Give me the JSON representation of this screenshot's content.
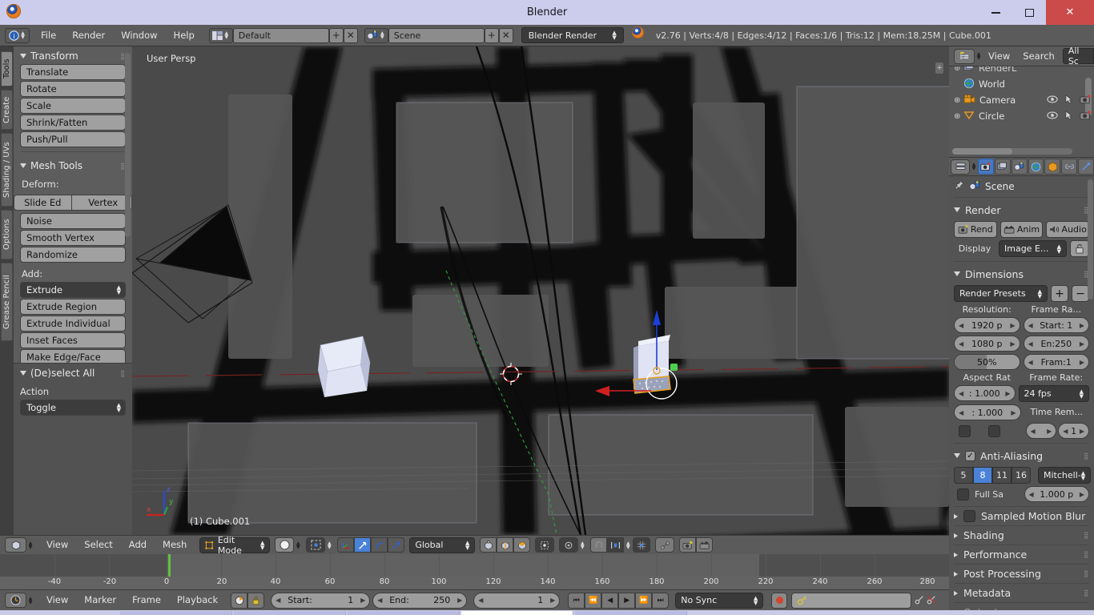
{
  "window": {
    "title": "Blender",
    "app_icon": "blender-logo-icon",
    "minimize": "minimize-icon",
    "maximize": "maximize-icon",
    "close": "close-icon"
  },
  "topbar": {
    "editor_icon": "info-editor-icon",
    "menus": [
      "File",
      "Render",
      "Window",
      "Help"
    ],
    "screen_layout": {
      "icon": "screen-layout-icon",
      "value": "Default",
      "add": "+",
      "remove": "x"
    },
    "scene": {
      "icon": "scene-icon",
      "value": "Scene",
      "add": "+",
      "remove": "x"
    },
    "render_engine": "Blender Render",
    "stats_icon": "blender-logo-icon",
    "stats": "v2.76 | Verts:4/8 | Edges:4/12 | Faces:1/6 | Tris:12 | Mem:18.25M | Cube.001"
  },
  "left_tabs": [
    {
      "label": "Tools",
      "active": true
    },
    {
      "label": "Create",
      "active": false
    },
    {
      "label": "Shading / UVs",
      "active": false
    },
    {
      "label": "Options",
      "active": false
    },
    {
      "label": "Grease Pencil",
      "active": false
    }
  ],
  "tool_shelf": {
    "transform": {
      "title": "Transform",
      "buttons": [
        "Translate",
        "Rotate",
        "Scale",
        "Shrink/Fatten",
        "Push/Pull"
      ]
    },
    "mesh_tools": {
      "title": "Mesh Tools",
      "deform_label": "Deform:",
      "deform_split": [
        "Slide Ed",
        "Vertex"
      ],
      "deform_buttons": [
        "Noise",
        "Smooth Vertex",
        "Randomize"
      ],
      "add_label": "Add:",
      "add_dropdown": "Extrude",
      "add_buttons": [
        "Extrude Region",
        "Extrude Individual",
        "Inset Faces",
        "Make Edge/Face"
      ]
    }
  },
  "operator_panel": {
    "title": "(De)select All",
    "action_label": "Action",
    "action_value": "Toggle"
  },
  "viewport": {
    "view_label": "User Persp",
    "object_label": "(1) Cube.001",
    "axis_gizmo": {
      "x": "x",
      "y": "y",
      "z": "z"
    },
    "colors": {
      "background": "#4a4a4a",
      "wall_dark": "#050505",
      "floor": "#555555",
      "cube_light": "#d8dced",
      "gizmo_z": "#1b3fd8",
      "gizmo_x": "#d82222",
      "gizmo_y": "#3cc23c",
      "cursor_red": "#c33",
      "selected_outline": "#e8a021"
    }
  },
  "viewport_header": {
    "editor_icon": "3d-view-icon",
    "menus": [
      "View",
      "Select",
      "Add",
      "Mesh"
    ],
    "mode": {
      "icon": "edit-mode-icon",
      "value": "Edit Mode"
    },
    "shading": "solid-shading-icon",
    "pivot": "pivot-median-icon",
    "snap_modes": [
      "manipulator-icon",
      "translate-manip-icon",
      "rotate-manip-icon",
      "scale-manip-icon"
    ],
    "orientation": "Global",
    "mesh_select_modes": [
      "vertex-select-icon",
      "edge-select-icon",
      "face-select-icon"
    ],
    "limit_selection": "limit-selection-icon",
    "proportional": "proportional-edit-icon",
    "proportional_falloff": "falloff-smooth-icon",
    "snap_magnet": "magnet-icon",
    "snap_target": "snap-target-icon",
    "snap_element": "snap-element-icon",
    "auto_merge": "automerge-icon",
    "render_opengl": "render-opengl-icon",
    "render_opengl_anim": "render-opengl-anim-icon"
  },
  "timeline": {
    "ticks": [
      -40,
      -20,
      0,
      20,
      40,
      60,
      80,
      100,
      120,
      140,
      160,
      180,
      200,
      220,
      240,
      260,
      280
    ],
    "playhead_frame": 1,
    "range_start": 1,
    "range_end": 250
  },
  "timeline_header": {
    "editor_icon": "timeline-icon",
    "menus": [
      "View",
      "Marker",
      "Frame",
      "Playback"
    ],
    "toggles": [
      "only-selected-icon",
      "lock-time-icon"
    ],
    "start_label": "Start:",
    "start_value": "1",
    "end_label": "End:",
    "end_value": "250",
    "current_frame": "1",
    "transport": [
      "jump-start-icon",
      "prev-keyframe-icon",
      "play-reverse-icon",
      "play-icon",
      "next-keyframe-icon",
      "jump-end-icon"
    ],
    "sync_mode": "No Sync",
    "record_icon": "record-icon",
    "keying_set_icon": "keyingset-icon",
    "keying_set_value": "",
    "add_keyframe_icon": "add-keyframe-icon",
    "remove_keyframe_icon": "remove-keyframe-icon"
  },
  "outliner": {
    "editor_icon": "outliner-icon",
    "menus": [
      "View",
      "Search"
    ],
    "display_mode": "All Sc",
    "rows": [
      {
        "icon": "renderlayer-icon",
        "label": "RenderL",
        "expander": true,
        "cols": []
      },
      {
        "icon": "world-icon",
        "label": "World",
        "expander": false,
        "cols": []
      },
      {
        "icon": "camera-icon",
        "label": "Camera",
        "expander": true,
        "cols": [
          "eye-icon",
          "cursor-arrow-icon",
          "camera-render-icon"
        ]
      },
      {
        "icon": "circle-mesh-icon",
        "label": "Circle",
        "expander": true,
        "cols": [
          "eye-icon",
          "cursor-arrow-icon",
          "camera-render-icon"
        ]
      }
    ]
  },
  "properties": {
    "tabs": [
      "render-tab-icon",
      "renderlayers-tab-icon",
      "scene-tab-icon",
      "world-tab-icon",
      "object-tab-icon",
      "constraints-tab-icon",
      "modifiers-tab-icon"
    ],
    "active_tab_index": 0,
    "breadcrumb_icon": "pin-icon",
    "breadcrumb_scene_icon": "scene-icon",
    "breadcrumb": "Scene",
    "render": {
      "title": "Render",
      "buttons": [
        {
          "icon": "render-still-icon",
          "label": "Rend"
        },
        {
          "icon": "render-anim-icon",
          "label": "Anim"
        },
        {
          "icon": "render-audio-icon",
          "label": "Audio"
        }
      ],
      "display_label": "Display",
      "display_value": "Image E...",
      "display_lock_icon": "lock-icon"
    },
    "dimensions": {
      "title": "Dimensions",
      "presets": "Render Presets",
      "preset_add": "+",
      "preset_remove": "−",
      "resolution_label": "Resolution:",
      "resolution_x": "1920 p",
      "resolution_y": "1080 p",
      "resolution_pct": "50%",
      "frame_range_label": "Frame Ra...",
      "frame_start": "Start: 1",
      "frame_end": "En:250",
      "frame_step": "Fram:1",
      "aspect_label": "Aspect Rat",
      "aspect_x": ": 1.000",
      "aspect_y": ": 1.000",
      "border_checks": [
        "border-checkbox",
        "crop-checkbox"
      ],
      "framerate_label": "Frame Rate:",
      "framerate_value": "24 fps",
      "time_remap_label": "Time Rem...",
      "time_remap_old": "",
      "time_remap_new": "1"
    },
    "anti_aliasing": {
      "title": "Anti-Aliasing",
      "enabled": true,
      "samples": [
        "5",
        "8",
        "11",
        "16"
      ],
      "active_sample": "8",
      "filter": "Mitchell-",
      "full_sample_label": "Full Sa",
      "full_sample_checked": false,
      "size_value": "1.000 p"
    },
    "collapsed_sections": [
      {
        "label": "Sampled Motion Blur",
        "checkbox": true
      },
      {
        "label": "Shading",
        "checkbox": false
      },
      {
        "label": "Performance",
        "checkbox": false
      },
      {
        "label": "Post Processing",
        "checkbox": false
      },
      {
        "label": "Metadata",
        "checkbox": false
      },
      {
        "label": "Output",
        "checkbox": false
      }
    ]
  }
}
